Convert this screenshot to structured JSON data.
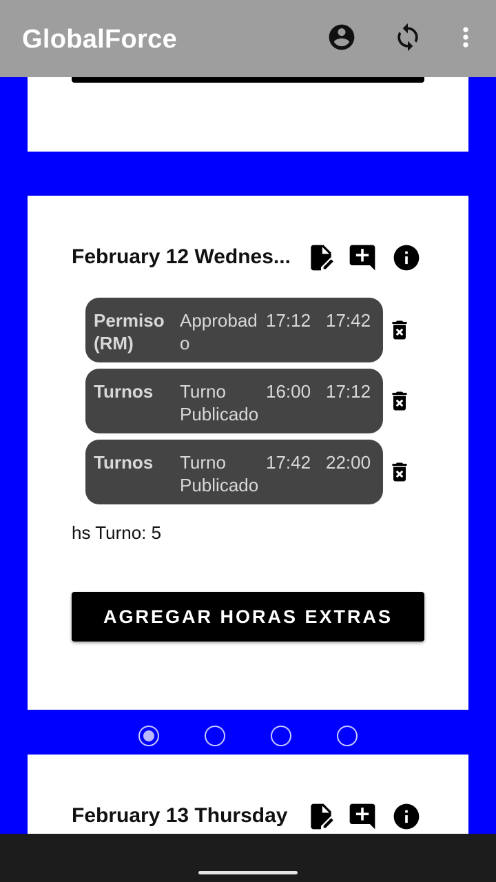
{
  "app": {
    "title": "GlobalForce"
  },
  "appbar_icons": [
    "account-circle-icon",
    "sync-icon",
    "more-vert-icon"
  ],
  "days": [
    {
      "title": "February 12 Wednes...",
      "entries": [
        {
          "type": "Permiso (RM)",
          "status": "Approbad o",
          "start": "17:12",
          "end": "17:42"
        },
        {
          "type": "Turnos",
          "status": "Turno Publicado",
          "start": "16:00",
          "end": "17:12"
        },
        {
          "type": "Turnos",
          "status": "Turno Publicado",
          "start": "17:42",
          "end": "22:00"
        }
      ],
      "hours_label": "hs Turno: 5",
      "extra_button": "AGREGAR HORAS EXTRAS"
    },
    {
      "title": "February 13 Thursday"
    }
  ],
  "pager": {
    "count": 4,
    "active": 0
  },
  "colors": {
    "appbar": "#9e9e9e",
    "background": "#0000ff",
    "entry": "#444444",
    "button": "#000000"
  }
}
